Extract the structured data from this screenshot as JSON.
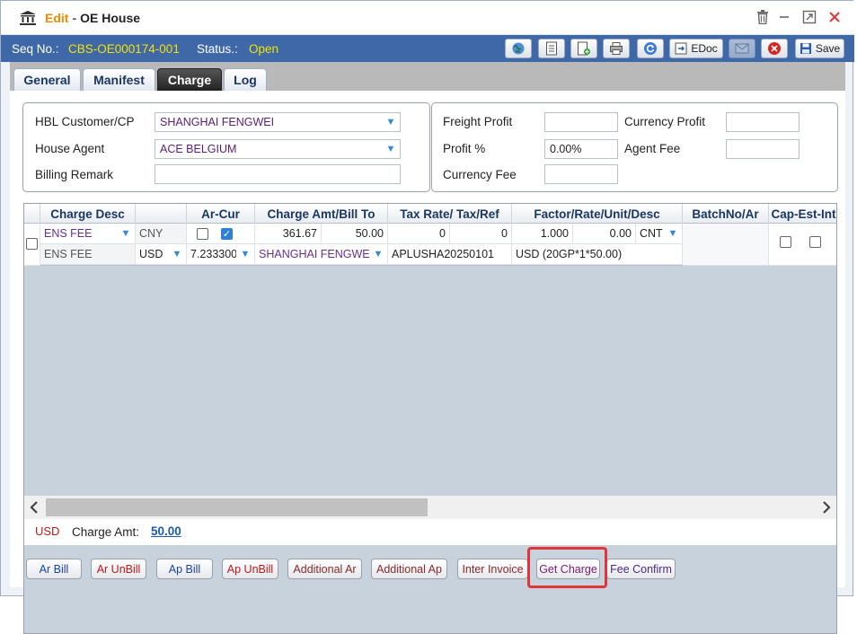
{
  "window": {
    "edit_label": "Edit",
    "separator": "-",
    "name": "OE House"
  },
  "info": {
    "seq_label": "Seq No.:",
    "seq_value": "CBS-OE000174-001",
    "status_label": "Status.:",
    "status_value": "Open"
  },
  "toolbar": {
    "edoc_label": "EDoc",
    "save_label": "Save"
  },
  "tabs": [
    {
      "label": "General"
    },
    {
      "label": "Manifest"
    },
    {
      "label": "Charge",
      "active": true
    },
    {
      "label": "Log"
    }
  ],
  "form": {
    "hbl_customer_label": "HBL Customer/CP",
    "hbl_customer_value": "SHANGHAI FENGWEI",
    "house_agent_label": "House Agent",
    "house_agent_value": "ACE BELGIUM",
    "billing_remark_label": "Billing Remark",
    "billing_remark_value": "",
    "freight_profit_label": "Freight Profit",
    "freight_profit_value": "",
    "currency_profit_label": "Currency Profit",
    "currency_profit_value": "",
    "profit_pct_label": "Profit %",
    "profit_pct_value": "0.00%",
    "agent_fee_label": "Agent Fee",
    "agent_fee_value": "",
    "currency_fee_label": "Currency Fee",
    "currency_fee_value": ""
  },
  "grid": {
    "columns": [
      "Charge Desc",
      "Ar-Cur",
      "Charge Amt/Bill To",
      "Tax Rate/ Tax/Ref",
      "Factor/Rate/Unit/Desc",
      "BatchNo/Ar",
      "Cap-Est-Int"
    ],
    "row1": {
      "charge_desc": "ENS FEE",
      "ar_cur": "CNY",
      "charge_amt": "361.67",
      "bill_amt": "50.00",
      "tax_rate": "0",
      "tax": "0",
      "factor": "1.000",
      "rate": "0.00",
      "unit": "CNT"
    },
    "row2": {
      "charge_desc": "ENS FEE",
      "currency": "USD",
      "exchange_rate": "7.233300",
      "bill_to": "SHANGHAI FENGWEI",
      "ref": "APLUSHA20250101",
      "desc": "USD (20GP*1*50.00)"
    }
  },
  "summary": {
    "currency": "USD",
    "charge_amt_label": "Charge Amt:",
    "charge_amt_value": "50.00"
  },
  "actions": [
    {
      "label": "Ar Bill"
    },
    {
      "label": "Ar UnBill"
    },
    {
      "label": "Ap Bill"
    },
    {
      "label": "Ap UnBill"
    },
    {
      "label": "Additional Ar"
    },
    {
      "label": "Additional Ap"
    },
    {
      "label": "Inter Invoice"
    },
    {
      "label": "Get Charge"
    },
    {
      "label": "Fee Confirm"
    }
  ],
  "colors": {
    "header_blue": "#3f68a8",
    "accent_orange": "#f08c00",
    "status_yellow": "#f5e100",
    "highlight_red": "#e0363a"
  }
}
